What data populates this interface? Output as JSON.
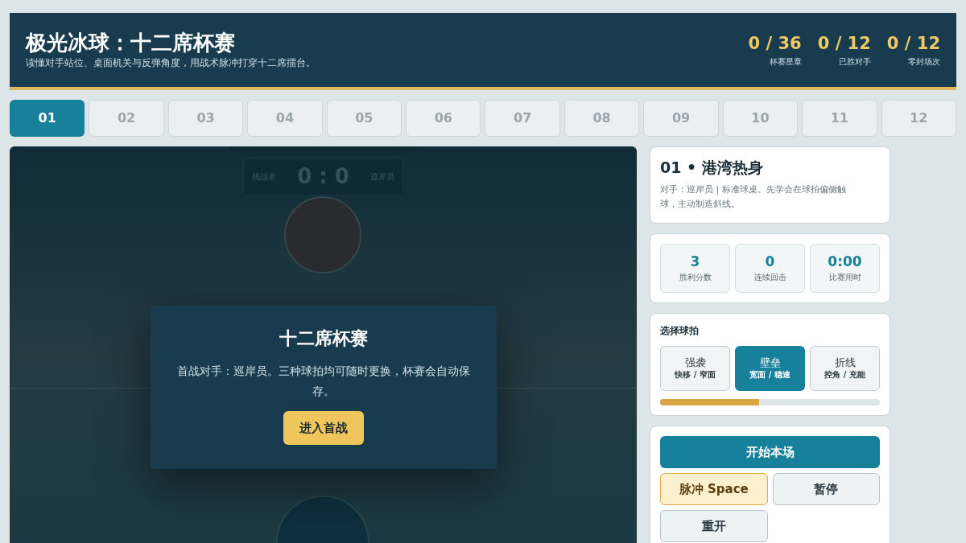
{
  "header": {
    "title": "极光冰球：十二席杯赛",
    "subtitle": "读懂对手站位、桌面机关与反弹角度，用战术脉冲打穿十二席擂台。",
    "stats": [
      {
        "value": "0 / 36",
        "label": "杯赛星章"
      },
      {
        "value": "0 / 12",
        "label": "已胜对手"
      },
      {
        "value": "0 / 12",
        "label": "零封场次"
      }
    ]
  },
  "levels": [
    {
      "label": "01",
      "selected": true
    },
    {
      "label": "02",
      "selected": false
    },
    {
      "label": "03",
      "selected": false
    },
    {
      "label": "04",
      "selected": false
    },
    {
      "label": "05",
      "selected": false
    },
    {
      "label": "06",
      "selected": false
    },
    {
      "label": "07",
      "selected": false
    },
    {
      "label": "08",
      "selected": false
    },
    {
      "label": "09",
      "selected": false
    },
    {
      "label": "10",
      "selected": false
    },
    {
      "label": "11",
      "selected": false
    },
    {
      "label": "12",
      "selected": false
    }
  ],
  "arena": {
    "scoreboard": {
      "left": "挑战者",
      "score": "0 : 0",
      "right": "巡岸员"
    },
    "overlay": {
      "title": "十二席杯赛",
      "text": "首战对手：巡岸员。三种球拍均可随时更换，杯赛会自动保存。",
      "button": "进入首战"
    }
  },
  "match": {
    "title": "01 • 港湾热身",
    "description": "对手：巡岸员 | 标准球桌。先学会在球拍偏侧触球，主动制造斜线。"
  },
  "metrics": [
    {
      "value": "3",
      "label": "胜利分数"
    },
    {
      "value": "0",
      "label": "连续回击"
    },
    {
      "value": "0:00",
      "label": "比赛用时"
    }
  ],
  "paddles": {
    "title": "选择球拍",
    "options": [
      {
        "name": "强袭",
        "traits": "快移 / 窄面",
        "selected": false
      },
      {
        "name": "壁垒",
        "traits": "宽面 / 稳速",
        "selected": true
      },
      {
        "name": "折线",
        "traits": "控角 / 充能",
        "selected": false
      }
    ],
    "level": 0.45
  },
  "controls": {
    "start": "开始本场",
    "pulse": "脉冲 Space",
    "pause": "暂停",
    "restart": "重开"
  }
}
